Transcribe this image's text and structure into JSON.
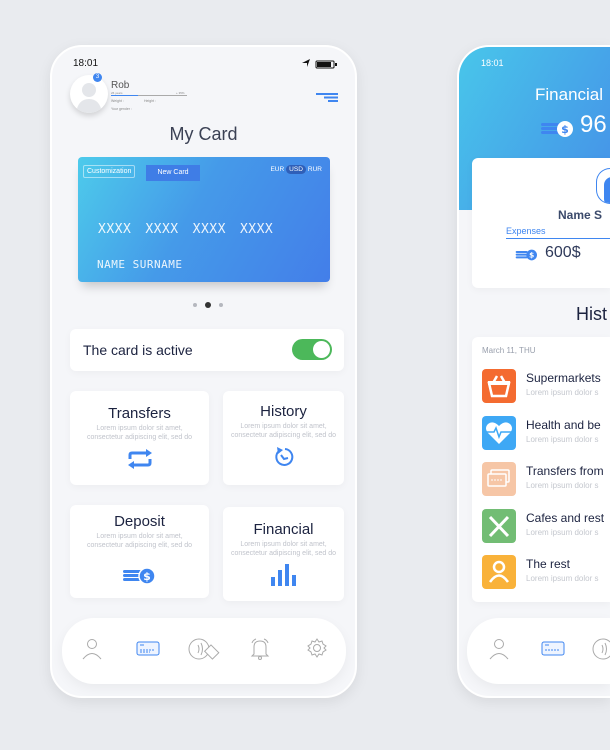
{
  "colors": {
    "accent": "#3f86f0",
    "toggle": "#4cb85a"
  },
  "screen1": {
    "status_time": "18:01",
    "profile": {
      "badge": "3",
      "name": "Rob",
      "age": "26 years",
      "progress": "+ 35%",
      "progress_value": 35,
      "weight_label": "Weight :",
      "height_label": "Height :",
      "gender_label": "Your gender :"
    },
    "title": "My Card",
    "card": {
      "customization": "Customization",
      "new_card": "New Card",
      "currencies": [
        "EUR",
        "USD",
        "RUR"
      ],
      "selected_currency": "USD",
      "number": [
        "XXXX",
        "XXXX",
        "XXXX",
        "XXXX"
      ],
      "holder": "NAME SURNAME"
    },
    "carousel": {
      "pages": 3,
      "active": 2
    },
    "active_row": {
      "label": "The card is active",
      "toggle_on": true
    },
    "tiles": [
      {
        "title": "Transfers",
        "desc": "Lorem ipsum dolor sit amet, consectetur adipiscing elit, sed do",
        "icon": "repeat-icon"
      },
      {
        "title": "History",
        "desc": "Lorem ipsum dolor sit amet, consectetur adipiscing elit, sed do",
        "icon": "history-icon"
      },
      {
        "title": "Deposit",
        "desc": "Lorem ipsum dolor sit amet, consectetur adipiscing elit, sed do",
        "icon": "coins-icon"
      },
      {
        "title": "Financial",
        "desc": "Lorem ipsum dolor sit amet, consectetur adipiscing elit, sed do",
        "icon": "bar-chart-icon"
      }
    ],
    "nav": [
      "user-icon",
      "card-icon",
      "contactless-icon",
      "bell-icon",
      "gear-icon"
    ],
    "nav_active": "card-icon"
  },
  "screen2": {
    "status_time": "18:01",
    "title": "Financial",
    "balance": "96",
    "name": "Name S",
    "expenses_label": "Expenses",
    "expenses_value": "600$",
    "history_title": "Hist",
    "date": "March 11, THU",
    "items": [
      {
        "title": "Supermarkets",
        "desc": "Lorem ipsum dolor s",
        "color": "#f46b30",
        "icon": "basket-icon"
      },
      {
        "title": "Health and be",
        "desc": "Lorem ipsum dolor s",
        "color": "#3ea8f5",
        "icon": "heart-pulse-icon"
      },
      {
        "title": "Transfers from",
        "desc": "Lorem ipsum dolor s",
        "color": "#f6c6a6",
        "icon": "cards-icon"
      },
      {
        "title": "Cafes and rest",
        "desc": "Lorem ipsum dolor s",
        "color": "#72bd74",
        "icon": "cutlery-icon"
      },
      {
        "title": "The rest",
        "desc": "Lorem ipsum dolor s",
        "color": "#f9b23a",
        "icon": "person-icon"
      }
    ]
  }
}
